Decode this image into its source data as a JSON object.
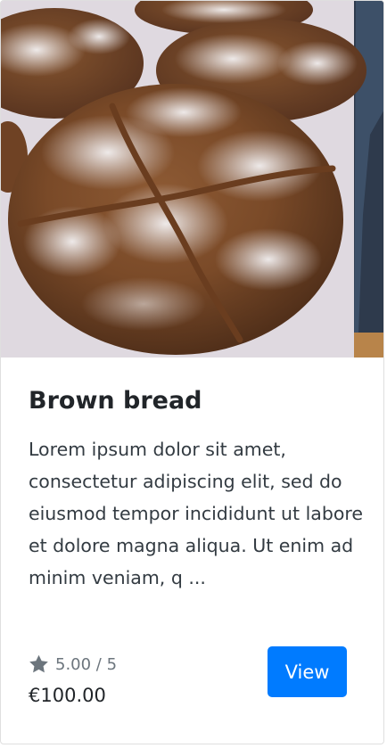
{
  "card": {
    "image_alt": "Brown bread",
    "title": "Brown bread",
    "description": "Lorem ipsum dolor sit amet, consectetur adipiscing elit, sed do eiusmod tempor incididunt ut labore et dolore magna aliqua. Ut enim ad minim veniam, q ...",
    "rating": {
      "icon": "star-icon",
      "text": "5.00 / 5",
      "value": 5.0,
      "max": 5
    },
    "price": "€100.00",
    "view_button_label": "View"
  },
  "colors": {
    "primary": "#007bff",
    "muted": "#6c757d",
    "text": "#212529"
  }
}
